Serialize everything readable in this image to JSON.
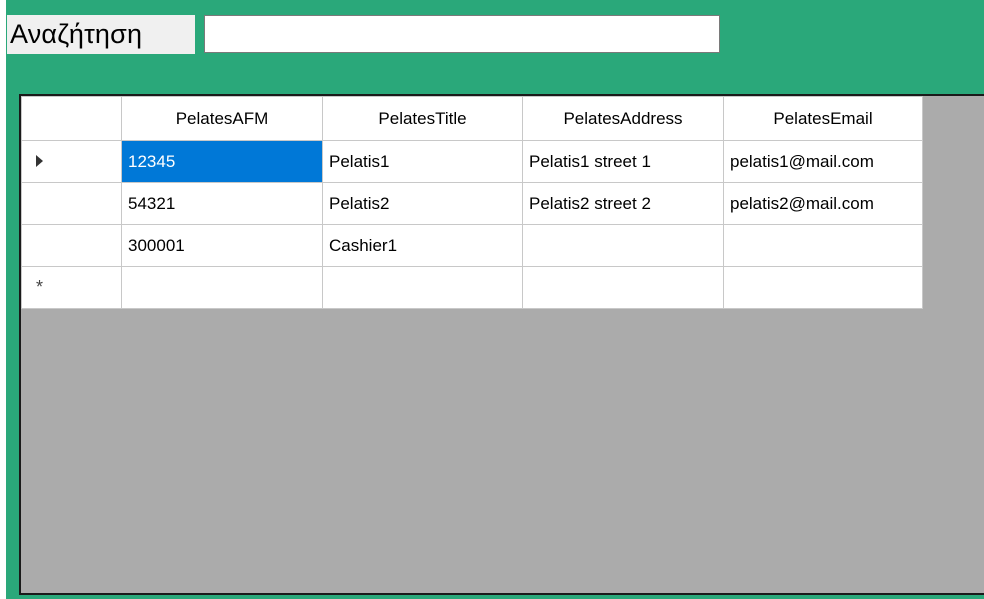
{
  "search": {
    "label": "Αναζήτηση",
    "value": "",
    "placeholder": ""
  },
  "grid": {
    "columns": [
      "PelatesAFM",
      "PelatesTitle",
      "PelatesAddress",
      "PelatesEmail"
    ],
    "rows": [
      [
        "12345",
        "Pelatis1",
        "Pelatis1 street 1",
        "pelatis1@mail.com"
      ],
      [
        "54321",
        "Pelatis2",
        "Pelatis2 street 2",
        "pelatis2@mail.com"
      ],
      [
        "300001",
        "Cashier1",
        "",
        ""
      ]
    ],
    "current_row_indicator": "arrow-right-icon",
    "new_row_indicator": "asterisk-icon",
    "selected_cell": {
      "row": 0,
      "column": "PelatesAFM"
    }
  },
  "colors": {
    "form_background": "#2aa87a",
    "grid_background": "#ababab",
    "selection": "#0078d7"
  }
}
